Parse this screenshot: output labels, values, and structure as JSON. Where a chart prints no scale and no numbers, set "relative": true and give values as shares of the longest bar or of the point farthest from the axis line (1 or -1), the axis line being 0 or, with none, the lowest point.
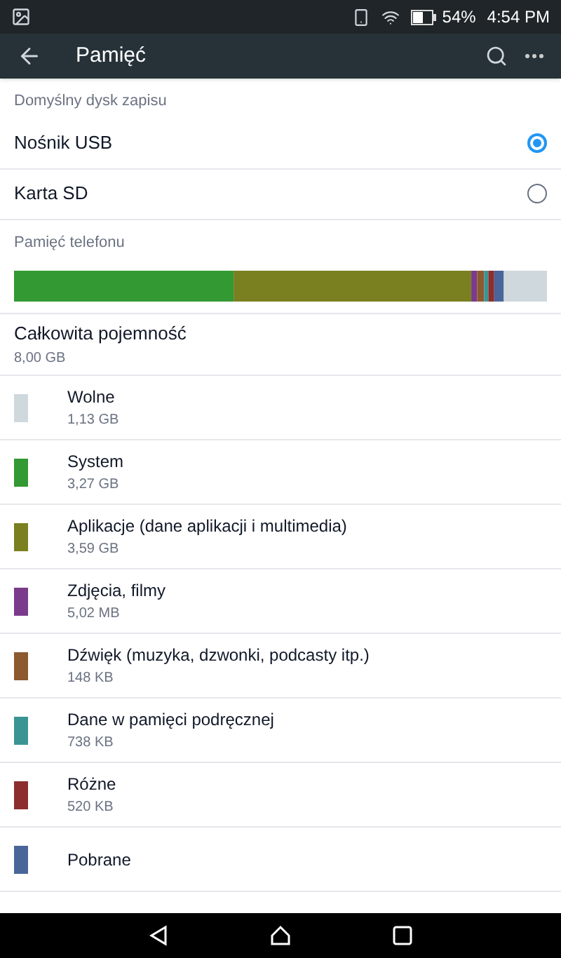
{
  "status_bar": {
    "battery": "54%",
    "time": "4:54 PM"
  },
  "toolbar": {
    "title": "Pamięć"
  },
  "default_disk": {
    "header": "Domyślny dysk zapisu",
    "options": [
      {
        "label": "Nośnik USB",
        "selected": true
      },
      {
        "label": "Karta SD",
        "selected": false
      }
    ]
  },
  "phone_storage": {
    "header": "Pamięć telefonu",
    "chart_data": {
      "type": "bar",
      "stacked": true,
      "relative": true,
      "orientation": "horizontal",
      "series": [
        {
          "name": "System",
          "color": "#339933",
          "values": [
            0.412
          ]
        },
        {
          "name": "Aplikacje (dane aplikacji i multimedia)",
          "color": "#7a8020",
          "values": [
            0.446
          ]
        },
        {
          "name": "Zdjęcia, filmy",
          "color": "#7a3b8c",
          "values": [
            0.011
          ]
        },
        {
          "name": "Dźwięk (muzyka, dzwonki, podcasty itp.)",
          "color": "#8c5a2e",
          "values": [
            0.013
          ]
        },
        {
          "name": "Dane w pamięci podręcznej",
          "color": "#3b9494",
          "values": [
            0.008
          ]
        },
        {
          "name": "Różne",
          "color": "#8c2e2e",
          "values": [
            0.011
          ]
        },
        {
          "name": "Pobrane",
          "color": "#4a6599",
          "values": [
            0.018
          ]
        },
        {
          "name": "Wolne",
          "color": "#cfd8dc",
          "values": [
            0.081
          ]
        }
      ]
    },
    "total_label": "Całkowita pojemność",
    "total_value": "8,00 GB",
    "sizes": [
      "1,13 GB",
      "3,27 GB",
      "3,59 GB",
      "5,02 MB",
      "148 KB",
      "738 KB",
      "520 KB"
    ]
  }
}
